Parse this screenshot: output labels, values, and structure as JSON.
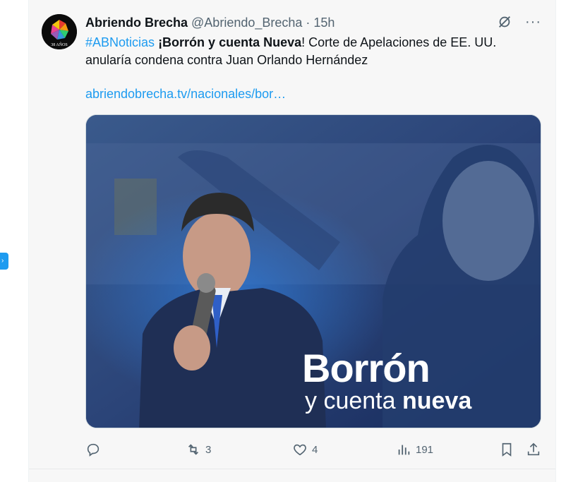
{
  "tweet": {
    "display_name": "Abriendo Brecha",
    "handle": "@Abriendo_Brecha",
    "separator": "·",
    "time": "15h",
    "avatar_text": "38 AÑOS",
    "hashtag": "#ABNoticias",
    "space": " ",
    "bold_text": "¡Borrón y cuenta Nueva",
    "text_rest": "! Corte de Apelaciones de EE. UU. anularía condena contra Juan Orlando Hernández",
    "link": "abriendobrecha.tv/nacionales/bor…",
    "more_label": "···"
  },
  "media": {
    "title": "Borrón",
    "subtitle_light": "y cuenta ",
    "subtitle_bold": "nueva"
  },
  "actions": {
    "reply_count": "",
    "retweet_count": "3",
    "like_count": "4",
    "views_count": "191"
  },
  "icons": [
    "grok-icon",
    "more-icon",
    "reply-icon",
    "retweet-icon",
    "like-icon",
    "views-icon",
    "bookmark-icon",
    "share-icon"
  ],
  "colors": {
    "accent": "#1d9bf0",
    "muted": "#536471",
    "text": "#0f1419"
  }
}
